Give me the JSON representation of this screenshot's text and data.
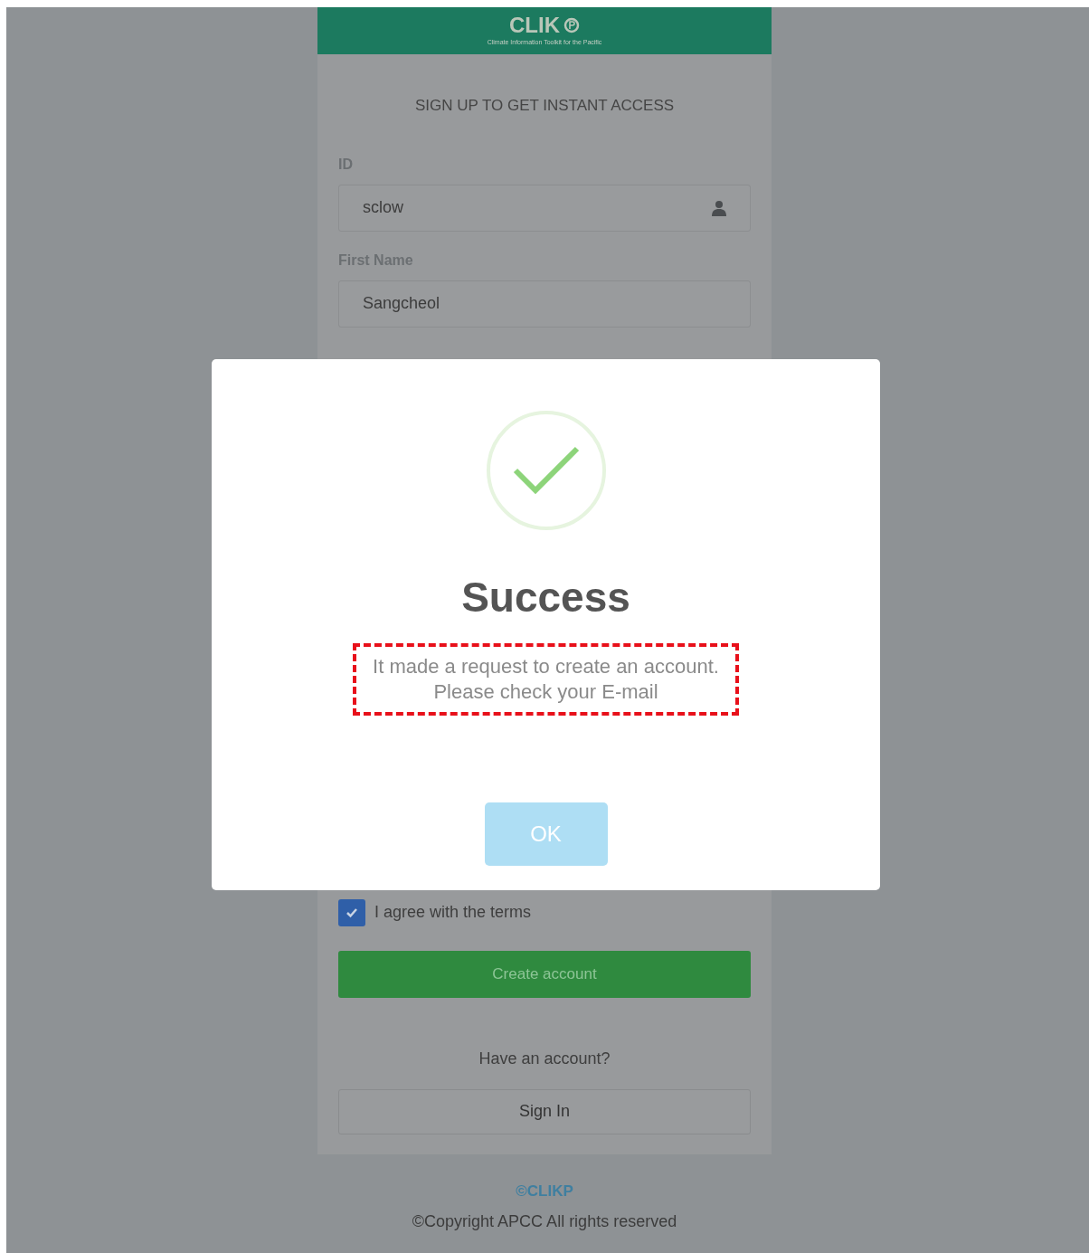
{
  "header": {
    "logo_title": "CLIK",
    "logo_subtitle": "Climate Information Toolkit for the Pacific"
  },
  "form": {
    "heading": "SIGN UP TO GET INSTANT ACCESS",
    "fields": [
      {
        "label": "ID",
        "value": "sclow",
        "kind": "user"
      },
      {
        "label": "First Name",
        "value": "Sangcheol",
        "kind": "plain"
      }
    ],
    "terms": {
      "label": "I agree with the terms",
      "checked": true
    },
    "create_button": "Create account",
    "signin_prompt": "Have an account?",
    "signin_button": "Sign In"
  },
  "footer": {
    "brand": "©CLIKP",
    "copyright": "©Copyright APCC All rights reserved"
  },
  "dialog": {
    "title": "Success",
    "message_lines": [
      "It made a request to create an account.",
      "Please check your E-mail"
    ],
    "ok_button": "OK",
    "highlighted": true
  }
}
